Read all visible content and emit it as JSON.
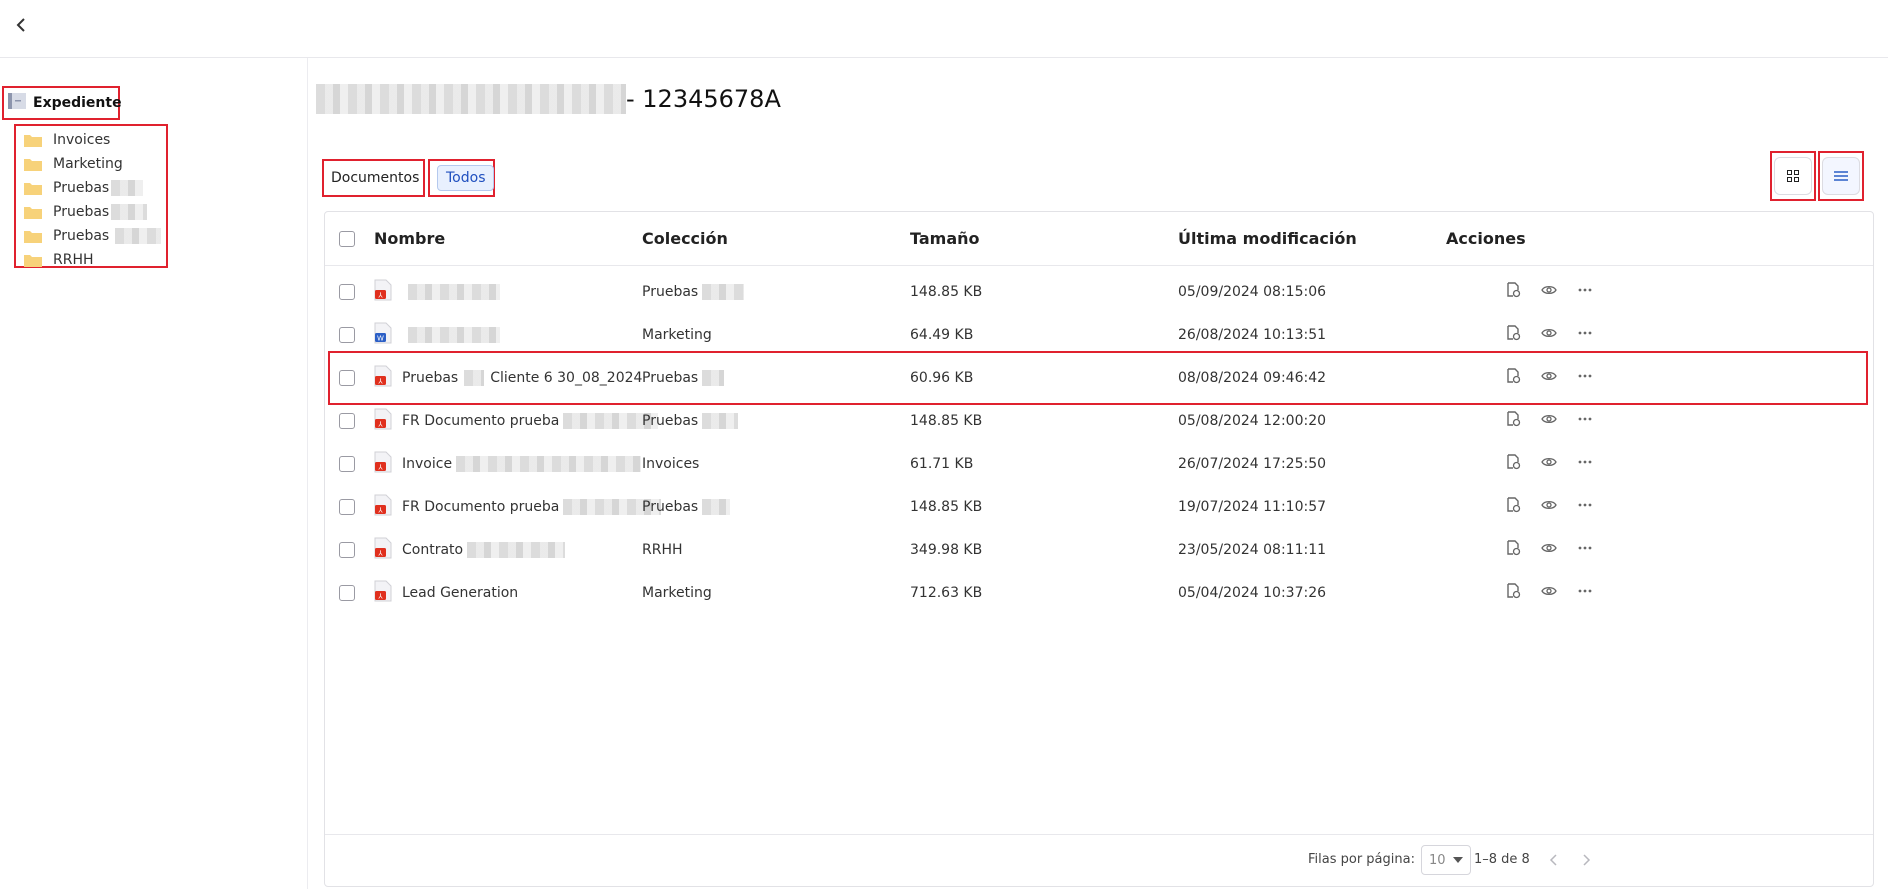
{
  "title_suffix": "- 12345678A",
  "sidebar": {
    "root_label": "Expediente",
    "items": [
      {
        "label": "Invoices",
        "redacted": 0
      },
      {
        "label": "Marketing",
        "redacted": 0
      },
      {
        "label": "Pruebas",
        "redacted": 32
      },
      {
        "label": "Pruebas",
        "redacted": 36
      },
      {
        "label": "Pruebas",
        "redacted": 46
      },
      {
        "label": "RRHH",
        "redacted": 0
      }
    ]
  },
  "filters": {
    "documents": "Documentos",
    "all": "Todos"
  },
  "table": {
    "headers": {
      "name": "Nombre",
      "collection": "Colección",
      "size": "Tamaño",
      "modified": "Última modificación",
      "actions": "Acciones"
    },
    "rows": [
      {
        "type": "pdf",
        "name": "",
        "collection": "Pruebas",
        "size": "148.85 KB",
        "modified": "05/09/2024 08:15:06"
      },
      {
        "type": "word",
        "name": "",
        "collection": "Marketing",
        "size": "64.49 KB",
        "modified": "26/08/2024 10:13:51"
      },
      {
        "type": "pdf",
        "name": "Cliente 6 30_08_2024",
        "collection": "Pruebas",
        "size": "60.96 KB",
        "modified": "08/08/2024 09:46:42",
        "name_prefix": "Pruebas"
      },
      {
        "type": "pdf",
        "name": "FR Documento prueba",
        "collection": "Pruebas",
        "size": "148.85 KB",
        "modified": "05/08/2024 12:00:20"
      },
      {
        "type": "pdf",
        "name": "Invoice",
        "collection": "Invoices",
        "size": "61.71 KB",
        "modified": "26/07/2024 17:25:50"
      },
      {
        "type": "pdf",
        "name": "FR Documento prueba",
        "collection": "Pruebas",
        "size": "148.85 KB",
        "modified": "19/07/2024 11:10:57"
      },
      {
        "type": "pdf",
        "name": "Contrato",
        "collection": "RRHH",
        "size": "349.98 KB",
        "modified": "23/05/2024 08:11:11"
      },
      {
        "type": "pdf",
        "name": "Lead Generation",
        "collection": "Marketing",
        "size": "712.63 KB",
        "modified": "05/04/2024 10:37:26"
      }
    ]
  },
  "footer": {
    "rows_per_page_label": "Filas por página:",
    "rows_per_page_value": "10",
    "range": "1–8 de 8"
  },
  "colors": {
    "highlight": "#e0212e",
    "pdf": "#e0301e",
    "word": "#2b5fc6",
    "folder": "#f7d27a",
    "selected_chip": "#1f4fbf"
  }
}
